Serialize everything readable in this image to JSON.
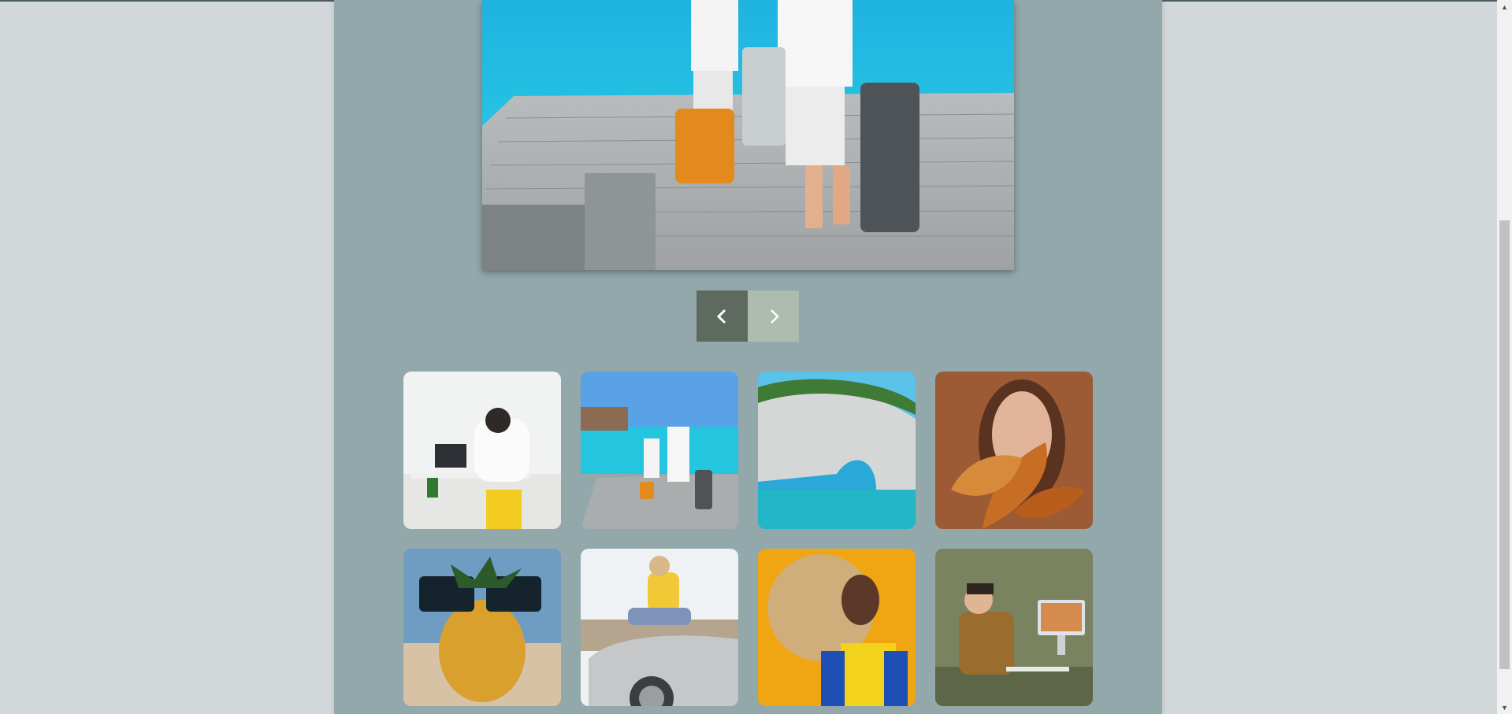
{
  "gallery": {
    "hero": {
      "icon": "hero-image-beach-pier-couple"
    },
    "nav": {
      "prev_label": "previous",
      "next_label": "next",
      "prev_icon": "chevron-left-icon",
      "next_icon": "chevron-right-icon"
    },
    "thumbnails": [
      {
        "name": "thumb-office-desk",
        "icon": "office-desk-photo"
      },
      {
        "name": "thumb-beach-pier",
        "icon": "beach-pier-photo"
      },
      {
        "name": "thumb-sea-arch",
        "icon": "sea-arch-photo"
      },
      {
        "name": "thumb-autumn-leaves",
        "icon": "autumn-leaves-photo"
      },
      {
        "name": "thumb-pineapple",
        "icon": "pineapple-sunglasses-photo"
      },
      {
        "name": "thumb-convertible-car",
        "icon": "convertible-car-photo"
      },
      {
        "name": "thumb-straw-hat",
        "icon": "straw-hat-photo"
      },
      {
        "name": "thumb-workstation",
        "icon": "workstation-photo"
      }
    ]
  },
  "colors": {
    "page_bg": "#d2d8da",
    "panel_bg": "#93a8ab",
    "prev_button": "#5e6a60",
    "next_button": "#aebcaf"
  },
  "scrollbar": {
    "up_icon": "triangle-up-icon",
    "down_icon": "triangle-down-icon"
  }
}
